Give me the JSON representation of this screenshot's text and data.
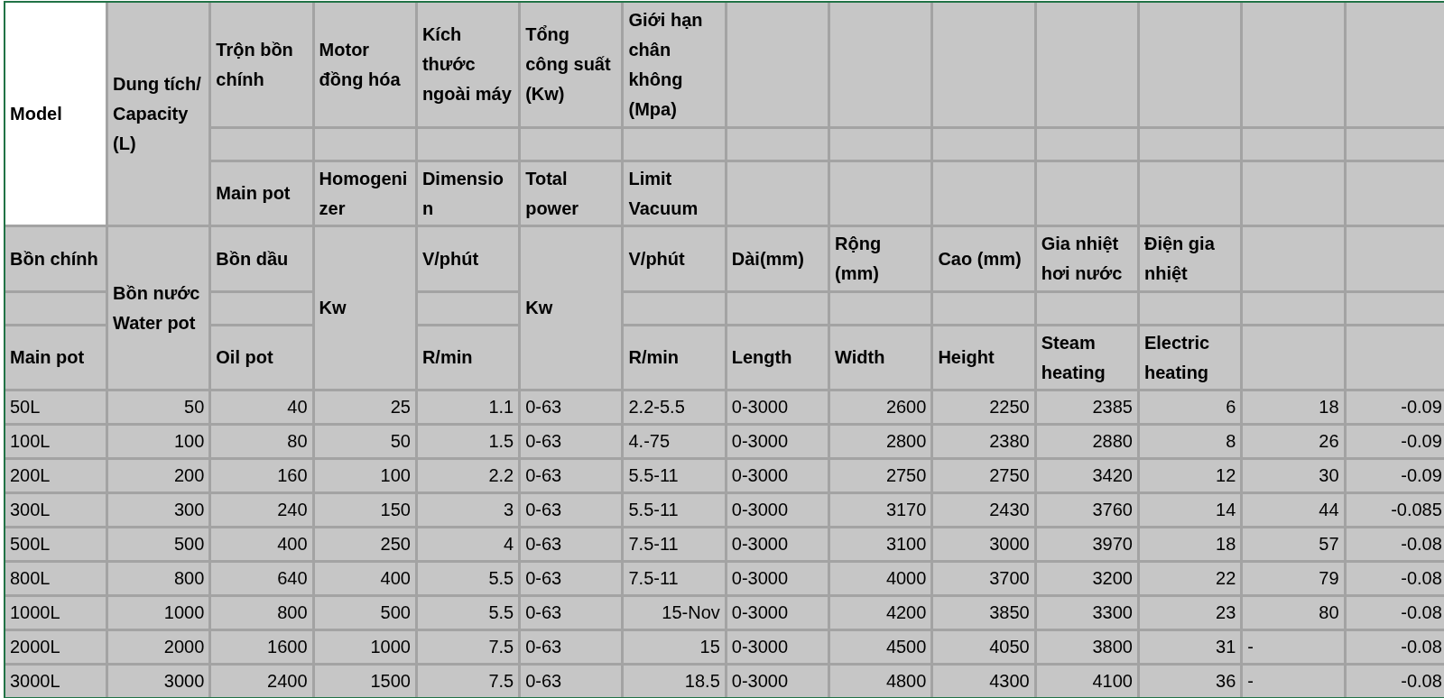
{
  "header_rows": [
    [
      {
        "kind": "text",
        "text": "Model",
        "highlight": true
      },
      {
        "kind": "text",
        "text": "Dung tích/ Capacity (L)"
      },
      {
        "kind": "text",
        "text": "Trộn bồn chính"
      },
      {
        "kind": "text",
        "text": "Motor đồng hóa"
      },
      {
        "kind": "text",
        "text": "Kích thước ngoài máy"
      },
      {
        "kind": "text",
        "text": "Tổng công suất (Kw)"
      },
      {
        "kind": "text",
        "text": "Giới hạn chân không (Mpa)"
      },
      {
        "kind": "empty"
      },
      {
        "kind": "empty"
      },
      {
        "kind": "empty"
      },
      {
        "kind": "empty"
      },
      {
        "kind": "empty"
      },
      {
        "kind": "empty"
      },
      {
        "kind": "empty"
      }
    ],
    [
      {
        "kind": "merged"
      },
      {
        "kind": "merged"
      },
      {
        "kind": "empty"
      },
      {
        "kind": "empty"
      },
      {
        "kind": "empty"
      },
      {
        "kind": "empty"
      },
      {
        "kind": "empty"
      },
      {
        "kind": "empty"
      },
      {
        "kind": "empty"
      },
      {
        "kind": "empty"
      },
      {
        "kind": "empty"
      },
      {
        "kind": "empty"
      },
      {
        "kind": "empty"
      },
      {
        "kind": "empty"
      }
    ],
    [
      {
        "kind": "merged"
      },
      {
        "kind": "merged"
      },
      {
        "kind": "text",
        "text": "Main pot"
      },
      {
        "kind": "text",
        "text": "Homogenizer"
      },
      {
        "kind": "text",
        "text": "Dimension"
      },
      {
        "kind": "text",
        "text": "Total power"
      },
      {
        "kind": "text",
        "text": "Limit Vacuum"
      },
      {
        "kind": "empty"
      },
      {
        "kind": "empty"
      },
      {
        "kind": "empty"
      },
      {
        "kind": "empty"
      },
      {
        "kind": "empty"
      },
      {
        "kind": "empty"
      },
      {
        "kind": "empty"
      }
    ],
    [
      {
        "kind": "text",
        "text": "Bồn chính"
      },
      {
        "kind": "text",
        "text": "Bồn nước Water pot"
      },
      {
        "kind": "text",
        "text": "Bồn dầu"
      },
      {
        "kind": "text",
        "text": "Kw"
      },
      {
        "kind": "text",
        "text": "V/phút"
      },
      {
        "kind": "text",
        "text": "Kw"
      },
      {
        "kind": "text",
        "text": "V/phút"
      },
      {
        "kind": "text",
        "text": "Dài(mm)"
      },
      {
        "kind": "text",
        "text": "Rộng (mm)"
      },
      {
        "kind": "text",
        "text": "Cao (mm)"
      },
      {
        "kind": "text",
        "text": "Gia nhiệt hơi nước"
      },
      {
        "kind": "text",
        "text": "Điện gia nhiệt"
      },
      {
        "kind": "empty"
      },
      {
        "kind": "empty"
      }
    ],
    [
      {
        "kind": "empty"
      },
      {
        "kind": "merged"
      },
      {
        "kind": "empty"
      },
      {
        "kind": "merged"
      },
      {
        "kind": "empty"
      },
      {
        "kind": "merged"
      },
      {
        "kind": "empty"
      },
      {
        "kind": "empty"
      },
      {
        "kind": "empty"
      },
      {
        "kind": "empty"
      },
      {
        "kind": "empty"
      },
      {
        "kind": "empty"
      },
      {
        "kind": "empty"
      },
      {
        "kind": "empty"
      }
    ],
    [
      {
        "kind": "text",
        "text": "Main pot"
      },
      {
        "kind": "merged"
      },
      {
        "kind": "text",
        "text": "Oil pot"
      },
      {
        "kind": "merged"
      },
      {
        "kind": "text",
        "text": "R/min"
      },
      {
        "kind": "merged"
      },
      {
        "kind": "text",
        "text": "R/min"
      },
      {
        "kind": "text",
        "text": "Length"
      },
      {
        "kind": "text",
        "text": "Width"
      },
      {
        "kind": "text",
        "text": "Height"
      },
      {
        "kind": "text",
        "text": "Steam heating"
      },
      {
        "kind": "text",
        "text": "Electric heating"
      },
      {
        "kind": "empty"
      },
      {
        "kind": "empty"
      }
    ]
  ],
  "rows": [
    [
      {
        "kind": "text",
        "text": "50L"
      },
      {
        "kind": "num",
        "text": "50"
      },
      {
        "kind": "num",
        "text": "40"
      },
      {
        "kind": "num",
        "text": "25"
      },
      {
        "kind": "num",
        "text": "1.1"
      },
      {
        "kind": "text",
        "text": "0-63"
      },
      {
        "kind": "text",
        "text": "2.2-5.5"
      },
      {
        "kind": "text",
        "text": "0-3000"
      },
      {
        "kind": "num",
        "text": "2600"
      },
      {
        "kind": "num",
        "text": "2250"
      },
      {
        "kind": "num",
        "text": "2385"
      },
      {
        "kind": "num",
        "text": "6"
      },
      {
        "kind": "num",
        "text": "18"
      },
      {
        "kind": "num",
        "text": "-0.09"
      }
    ],
    [
      {
        "kind": "text",
        "text": "100L"
      },
      {
        "kind": "num",
        "text": "100"
      },
      {
        "kind": "num",
        "text": "80"
      },
      {
        "kind": "num",
        "text": "50"
      },
      {
        "kind": "num",
        "text": "1.5"
      },
      {
        "kind": "text",
        "text": "0-63"
      },
      {
        "kind": "text",
        "text": "4.-75"
      },
      {
        "kind": "text",
        "text": "0-3000"
      },
      {
        "kind": "num",
        "text": "2800"
      },
      {
        "kind": "num",
        "text": "2380"
      },
      {
        "kind": "num",
        "text": "2880"
      },
      {
        "kind": "num",
        "text": "8"
      },
      {
        "kind": "num",
        "text": "26"
      },
      {
        "kind": "num",
        "text": "-0.09"
      }
    ],
    [
      {
        "kind": "text",
        "text": "200L"
      },
      {
        "kind": "num",
        "text": "200"
      },
      {
        "kind": "num",
        "text": "160"
      },
      {
        "kind": "num",
        "text": "100"
      },
      {
        "kind": "num",
        "text": "2.2"
      },
      {
        "kind": "text",
        "text": "0-63"
      },
      {
        "kind": "text",
        "text": "5.5-11"
      },
      {
        "kind": "text",
        "text": "0-3000"
      },
      {
        "kind": "num",
        "text": "2750"
      },
      {
        "kind": "num",
        "text": "2750"
      },
      {
        "kind": "num",
        "text": "3420"
      },
      {
        "kind": "num",
        "text": "12"
      },
      {
        "kind": "num",
        "text": "30"
      },
      {
        "kind": "num",
        "text": "-0.09"
      }
    ],
    [
      {
        "kind": "text",
        "text": "300L"
      },
      {
        "kind": "num",
        "text": "300"
      },
      {
        "kind": "num",
        "text": "240"
      },
      {
        "kind": "num",
        "text": "150"
      },
      {
        "kind": "num",
        "text": "3"
      },
      {
        "kind": "text",
        "text": "0-63"
      },
      {
        "kind": "text",
        "text": "5.5-11"
      },
      {
        "kind": "text",
        "text": "0-3000"
      },
      {
        "kind": "num",
        "text": "3170"
      },
      {
        "kind": "num",
        "text": "2430"
      },
      {
        "kind": "num",
        "text": "3760"
      },
      {
        "kind": "num",
        "text": "14"
      },
      {
        "kind": "num",
        "text": "44"
      },
      {
        "kind": "num",
        "text": "-0.085"
      }
    ],
    [
      {
        "kind": "text",
        "text": "500L"
      },
      {
        "kind": "num",
        "text": "500"
      },
      {
        "kind": "num",
        "text": "400"
      },
      {
        "kind": "num",
        "text": "250"
      },
      {
        "kind": "num",
        "text": "4"
      },
      {
        "kind": "text",
        "text": "0-63"
      },
      {
        "kind": "text",
        "text": "7.5-11"
      },
      {
        "kind": "text",
        "text": "0-3000"
      },
      {
        "kind": "num",
        "text": "3100"
      },
      {
        "kind": "num",
        "text": "3000"
      },
      {
        "kind": "num",
        "text": "3970"
      },
      {
        "kind": "num",
        "text": "18"
      },
      {
        "kind": "num",
        "text": "57"
      },
      {
        "kind": "num",
        "text": "-0.08"
      }
    ],
    [
      {
        "kind": "text",
        "text": "800L"
      },
      {
        "kind": "num",
        "text": "800"
      },
      {
        "kind": "num",
        "text": "640"
      },
      {
        "kind": "num",
        "text": "400"
      },
      {
        "kind": "num",
        "text": "5.5"
      },
      {
        "kind": "text",
        "text": "0-63"
      },
      {
        "kind": "text",
        "text": "7.5-11"
      },
      {
        "kind": "text",
        "text": "0-3000"
      },
      {
        "kind": "num",
        "text": "4000"
      },
      {
        "kind": "num",
        "text": "3700"
      },
      {
        "kind": "num",
        "text": "3200"
      },
      {
        "kind": "num",
        "text": "22"
      },
      {
        "kind": "num",
        "text": "79"
      },
      {
        "kind": "num",
        "text": "-0.08"
      }
    ],
    [
      {
        "kind": "text",
        "text": "1000L"
      },
      {
        "kind": "num",
        "text": "1000"
      },
      {
        "kind": "num",
        "text": "800"
      },
      {
        "kind": "num",
        "text": "500"
      },
      {
        "kind": "num",
        "text": "5.5"
      },
      {
        "kind": "text",
        "text": "0-63"
      },
      {
        "kind": "num",
        "text": "15-Nov"
      },
      {
        "kind": "text",
        "text": "0-3000"
      },
      {
        "kind": "num",
        "text": "4200"
      },
      {
        "kind": "num",
        "text": "3850"
      },
      {
        "kind": "num",
        "text": "3300"
      },
      {
        "kind": "num",
        "text": "23"
      },
      {
        "kind": "num",
        "text": "80"
      },
      {
        "kind": "num",
        "text": "-0.08"
      }
    ],
    [
      {
        "kind": "text",
        "text": "2000L"
      },
      {
        "kind": "num",
        "text": "2000"
      },
      {
        "kind": "num",
        "text": "1600"
      },
      {
        "kind": "num",
        "text": "1000"
      },
      {
        "kind": "num",
        "text": "7.5"
      },
      {
        "kind": "text",
        "text": "0-63"
      },
      {
        "kind": "num",
        "text": "15"
      },
      {
        "kind": "text",
        "text": "0-3000"
      },
      {
        "kind": "num",
        "text": "4500"
      },
      {
        "kind": "num",
        "text": "4050"
      },
      {
        "kind": "num",
        "text": "3800"
      },
      {
        "kind": "num",
        "text": "31"
      },
      {
        "kind": "text",
        "text": "-"
      },
      {
        "kind": "num",
        "text": "-0.08"
      }
    ],
    [
      {
        "kind": "text",
        "text": "3000L"
      },
      {
        "kind": "num",
        "text": "3000"
      },
      {
        "kind": "num",
        "text": "2400"
      },
      {
        "kind": "num",
        "text": "1500"
      },
      {
        "kind": "num",
        "text": "7.5"
      },
      {
        "kind": "text",
        "text": "0-63"
      },
      {
        "kind": "num",
        "text": "18.5"
      },
      {
        "kind": "text",
        "text": "0-3000"
      },
      {
        "kind": "num",
        "text": "4800"
      },
      {
        "kind": "num",
        "text": "4300"
      },
      {
        "kind": "num",
        "text": "4100"
      },
      {
        "kind": "num",
        "text": "36"
      },
      {
        "kind": "text",
        "text": "-"
      },
      {
        "kind": "num",
        "text": "-0.08"
      }
    ]
  ]
}
